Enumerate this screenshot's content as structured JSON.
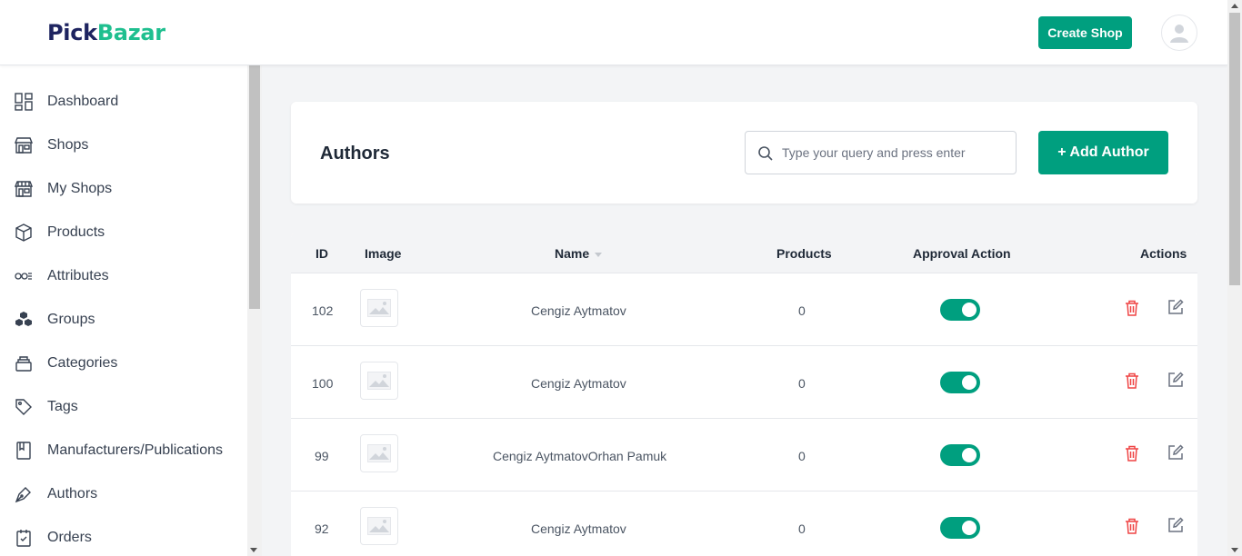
{
  "brand": {
    "part1": "Pick",
    "part2": "Bazar"
  },
  "header": {
    "create_shop_label": "Create Shop"
  },
  "sidebar": {
    "items": [
      {
        "label": "Dashboard",
        "icon": "dashboard-icon"
      },
      {
        "label": "Shops",
        "icon": "shop-icon"
      },
      {
        "label": "My Shops",
        "icon": "my-shops-icon"
      },
      {
        "label": "Products",
        "icon": "products-icon"
      },
      {
        "label": "Attributes",
        "icon": "attributes-icon"
      },
      {
        "label": "Groups",
        "icon": "groups-icon"
      },
      {
        "label": "Categories",
        "icon": "categories-icon"
      },
      {
        "label": "Tags",
        "icon": "tag-icon"
      },
      {
        "label": "Manufacturers/Publications",
        "icon": "book-icon"
      },
      {
        "label": "Authors",
        "icon": "pen-icon"
      },
      {
        "label": "Orders",
        "icon": "orders-icon"
      }
    ]
  },
  "page": {
    "title": "Authors",
    "search_placeholder": "Type your query and press enter",
    "add_button_label": "+ Add Author"
  },
  "table": {
    "columns": {
      "id": "ID",
      "image": "Image",
      "name": "Name",
      "products": "Products",
      "approval": "Approval Action",
      "actions": "Actions"
    },
    "rows": [
      {
        "id": "102",
        "name": "Cengiz Aytmatov",
        "products": "0",
        "approved": true
      },
      {
        "id": "100",
        "name": "Cengiz Aytmatov",
        "products": "0",
        "approved": true
      },
      {
        "id": "99",
        "name": "Cengiz AytmatovOrhan Pamuk",
        "products": "0",
        "approved": true
      },
      {
        "id": "92",
        "name": "Cengiz Aytmatov",
        "products": "0",
        "approved": true
      }
    ]
  },
  "colors": {
    "primary": "#009f7f",
    "danger": "#ef4444",
    "brand_dark": "#1e2460",
    "brand_green": "#1fbf8f"
  }
}
